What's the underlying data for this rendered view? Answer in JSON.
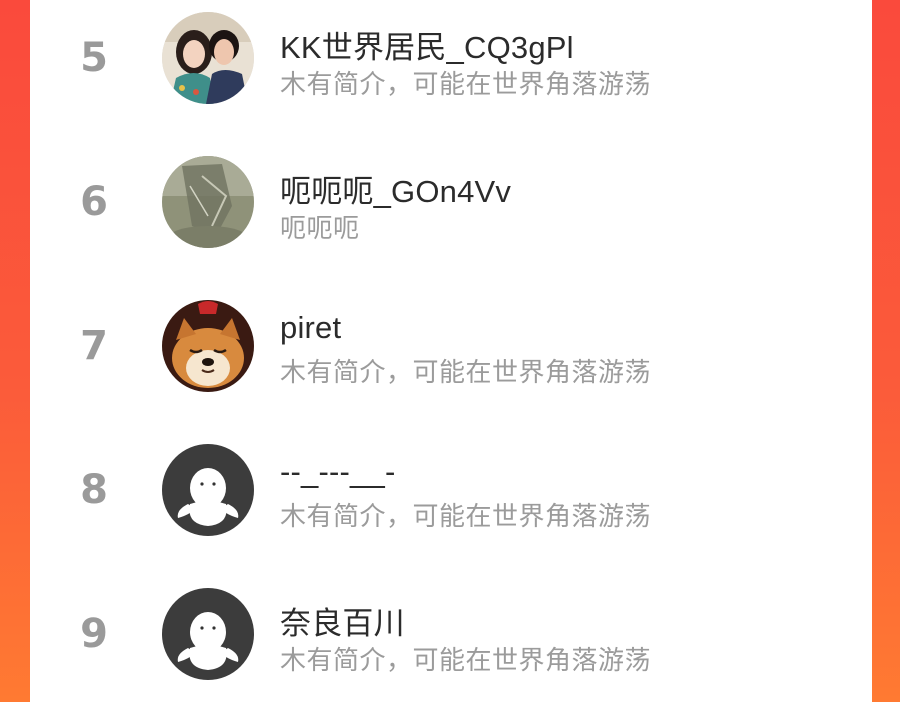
{
  "theme": {
    "background_gradient": [
      "#fa4a3c",
      "#ff7a32"
    ],
    "card_background": "#ffffff",
    "rank_color": "#9a9a9a",
    "name_color": "#2b2b2b",
    "bio_color": "#9b9b9b"
  },
  "users": [
    {
      "rank": "5",
      "name": "KK世界居民_CQ3gPl",
      "bio": "木有简介，可能在世界角落游荡",
      "avatar": "couple-photo-avatar"
    },
    {
      "rank": "6",
      "name": "呃呃呃_GOn4Vv",
      "bio": "呃呃呃",
      "avatar": "misty-landscape-avatar"
    },
    {
      "rank": "7",
      "name": "piret",
      "bio": "木有简介，可能在世界角落游荡",
      "avatar": "shiba-dog-avatar"
    },
    {
      "rank": "8",
      "name": "--_---__-",
      "bio": "木有简介，可能在世界角落游荡",
      "avatar": "default-person-avatar"
    },
    {
      "rank": "9",
      "name": "奈良百川",
      "bio": "木有简介，可能在世界角落游荡",
      "avatar": "default-person-avatar"
    }
  ]
}
